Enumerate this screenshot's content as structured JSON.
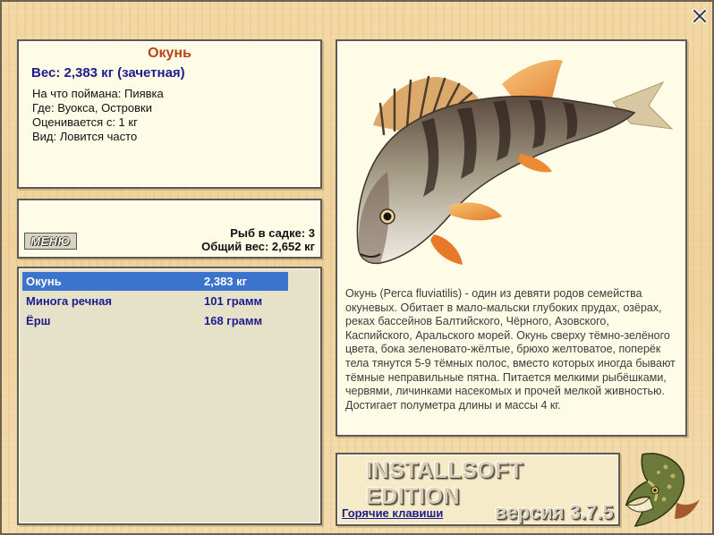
{
  "window": {
    "close_icon": "close-icon"
  },
  "fish": {
    "name": "Окунь",
    "weight_line": "Вес: 2,383 кг (зачетная)",
    "details": [
      "На что поймана: Пиявка",
      "Где: Вуокса, Островки",
      "Оценивается с: 1 кг",
      "Вид: Ловится часто"
    ],
    "description": "Окунь (Perca fluviatilis) - один из девяти родов семейства окуневых. Обитает в мало-мальски глубоких прудах, озёрах, реках бассейнов Балтийского, Чёрного, Азовского, Каспийского, Аральского морей. Окунь сверху тёмно-зелёного цвета, бока зеленовато-жёлтые, брюхо желтоватое, поперёк тела тянутся 5-9 тёмных полос, вместо которых иногда бывают тёмные неправильные пятна. Питается мелкими рыбёшками, червями, личинками насекомых и прочей мелкой живностью. Достигает полуметра длины и массы 4 кг."
  },
  "stats": {
    "menu_label": "МЕНЮ",
    "fish_in_keepnet": "Рыб в садке: 3",
    "total_weight": "Общий вес: 2,652 кг"
  },
  "catch_list": [
    {
      "name": "Окунь",
      "weight": "2,383 кг",
      "selected": true
    },
    {
      "name": "Минога речная",
      "weight": "101 грамм",
      "selected": false
    },
    {
      "name": "Ёрш",
      "weight": "168 грамм",
      "selected": false
    }
  ],
  "footer": {
    "edition": "INSTALLSOFT EDITION",
    "version": "версия 3.7.5",
    "hotkeys_link": "Горячие клавиши"
  },
  "colors": {
    "title": "#b5461a",
    "weight": "#1c1c8c",
    "selection": "#3c74cd",
    "panel_bg": "#fefbe7",
    "wood_bg": "#f3d9a6"
  }
}
